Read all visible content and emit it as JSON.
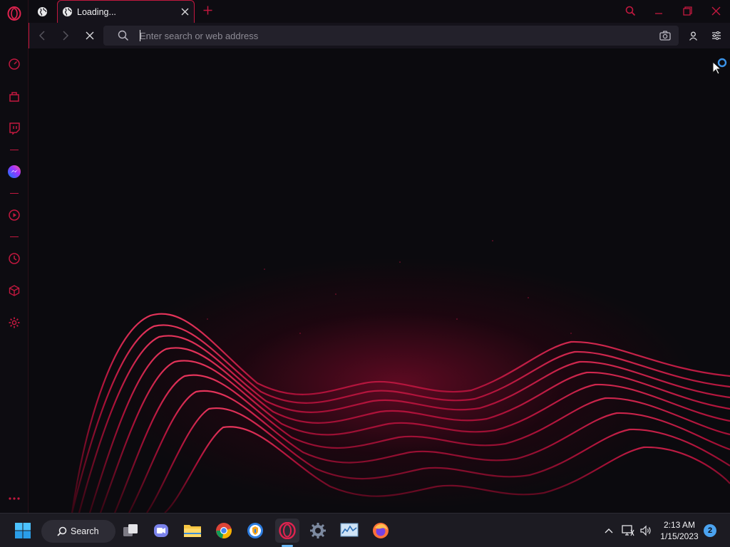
{
  "app": {
    "name": "Opera"
  },
  "tabs": [
    {
      "title": "",
      "pinned": true,
      "icon": "globe-icon"
    },
    {
      "title": "Loading...",
      "active": true,
      "icon": "globe-icon"
    }
  ],
  "address_bar": {
    "value": "",
    "placeholder": "Enter search or web address"
  },
  "taskbar": {
    "search_label": "Search",
    "clock": {
      "time": "2:13 AM",
      "date": "1/15/2023"
    },
    "notification_count": "2"
  },
  "colors": {
    "accent": "#c2183f",
    "background": "#0b0a0e",
    "taskbar": "#1c1b22"
  }
}
